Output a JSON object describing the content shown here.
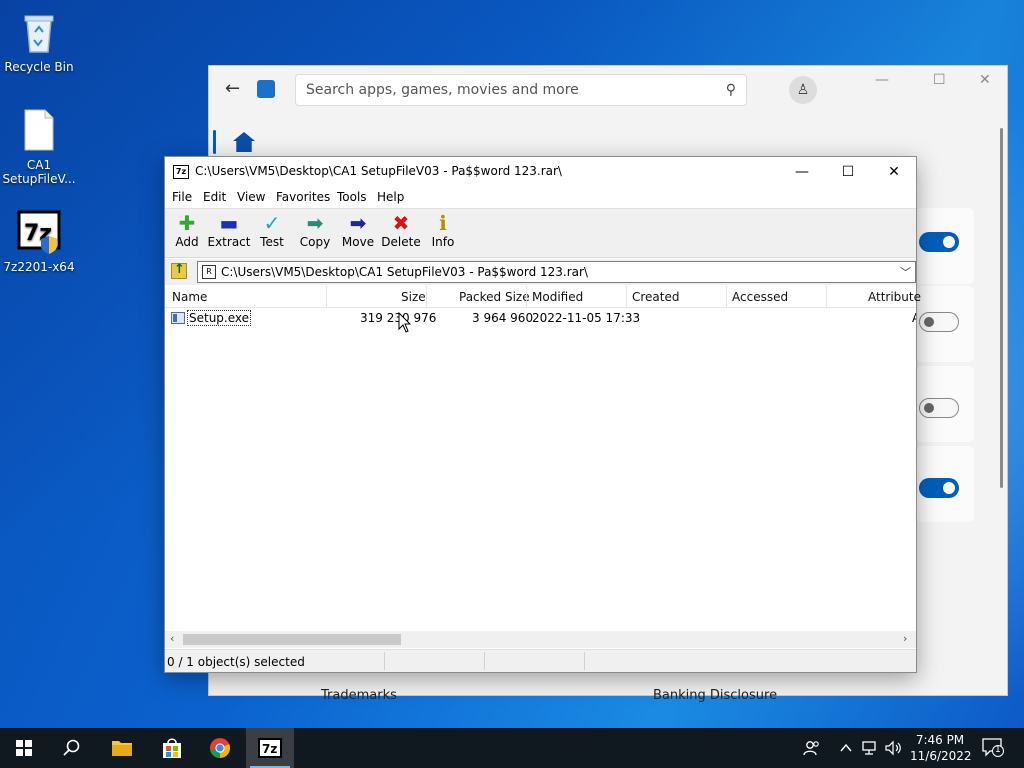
{
  "desktop": {
    "icons": [
      {
        "label": "Recycle Bin"
      },
      {
        "label": "CA1 SetupFileV..."
      },
      {
        "label": "7z2201-x64"
      }
    ]
  },
  "store": {
    "search_placeholder": "Search apps, games, movies and more",
    "footer": [
      "Trademarks",
      "Banking Disclosure"
    ]
  },
  "zip": {
    "title": "C:\\Users\\VM5\\Desktop\\CA1 SetupFileV03 - Pa$$word 123.rar\\",
    "app_icon_text": "7z",
    "menu": [
      "File",
      "Edit",
      "View",
      "Favorites",
      "Tools",
      "Help"
    ],
    "toolbar": [
      {
        "label": "Add",
        "icon": "plus-icon",
        "color": "#2eaa2e"
      },
      {
        "label": "Extract",
        "icon": "minus-icon",
        "color": "#1b2fb0"
      },
      {
        "label": "Test",
        "icon": "check-icon",
        "color": "#1aa5c8"
      },
      {
        "label": "Copy",
        "icon": "copy-arrow-icon",
        "color": "#2c8a7a"
      },
      {
        "label": "Move",
        "icon": "move-arrow-icon",
        "color": "#1b2a8f"
      },
      {
        "label": "Delete",
        "icon": "x-icon",
        "color": "#d11"
      },
      {
        "label": "Info",
        "icon": "info-icon",
        "color": "#b88a00"
      }
    ],
    "address": "C:\\Users\\VM5\\Desktop\\CA1 SetupFileV03 - Pa$$word 123.rar\\",
    "columns": [
      "Name",
      "Size",
      "Packed Size",
      "Modified",
      "Created",
      "Accessed",
      "Attribute"
    ],
    "rows": [
      {
        "name": "Setup.exe",
        "size": "319 230 976",
        "packed": "3 964 960",
        "modified": "2022-11-05 17:33",
        "created": "",
        "accessed": "",
        "attr": "A"
      }
    ],
    "status": "0 / 1 object(s) selected"
  },
  "taskbar": {
    "time": "7:46 PM",
    "date": "11/6/2022",
    "notifications": "1"
  }
}
